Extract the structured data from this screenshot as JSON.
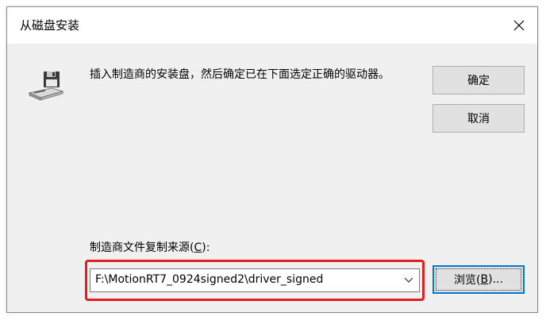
{
  "window": {
    "title": "从磁盘安装"
  },
  "icons": {
    "close": "close-icon",
    "disk": "floppy-disk-drive-icon",
    "dropdown": "chevron-down-icon"
  },
  "instruction": {
    "text": "插入制造商的安装盘，然后确定已在下面选定正确的驱动器。"
  },
  "buttons": {
    "ok_label": "确定",
    "cancel_label": "取消",
    "browse_prefix": "浏览(",
    "browse_mnemonic": "B",
    "browse_suffix": ")..."
  },
  "source": {
    "label_prefix": "制造商文件复制来源(",
    "label_mnemonic": "C",
    "label_suffix": "):",
    "value": "F:\\MotionRT7_0924signed2\\driver_signed"
  },
  "colors": {
    "highlight": "#e02020",
    "focus": "#0078d7"
  }
}
